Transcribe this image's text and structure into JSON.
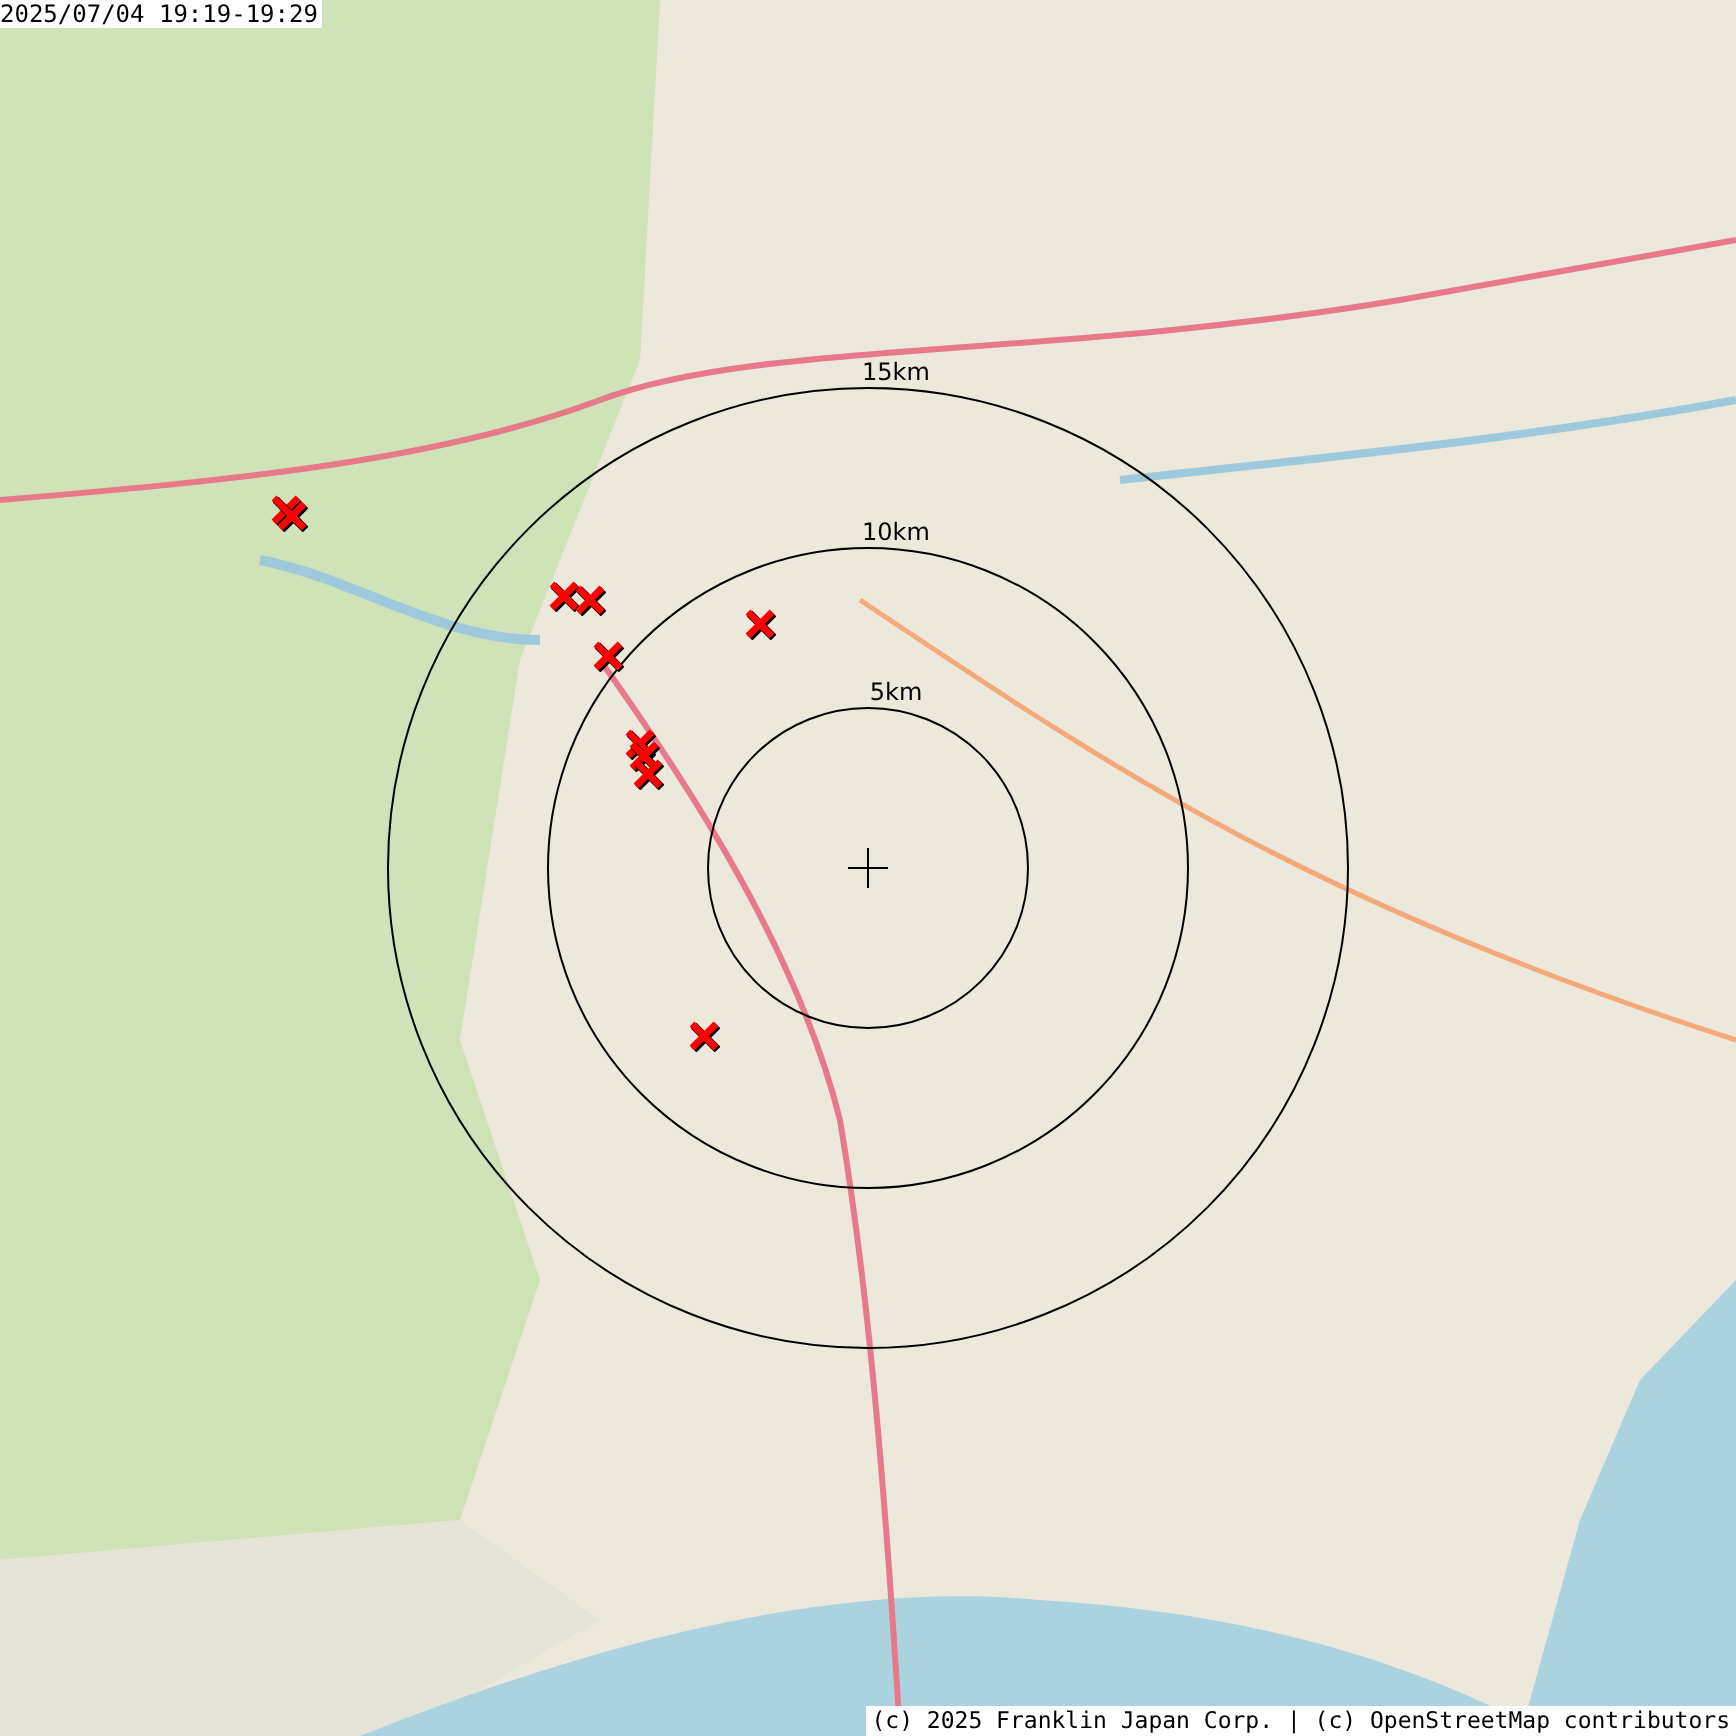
{
  "timestamp": "2025/07/04 19:19-19:29",
  "range_rings": [
    {
      "label": "15km"
    },
    {
      "label": "10km"
    },
    {
      "label": "5km"
    }
  ],
  "attribution": "(c) 2025 Franklin Japan Corp. | (c) OpenStreetMap contributors"
}
